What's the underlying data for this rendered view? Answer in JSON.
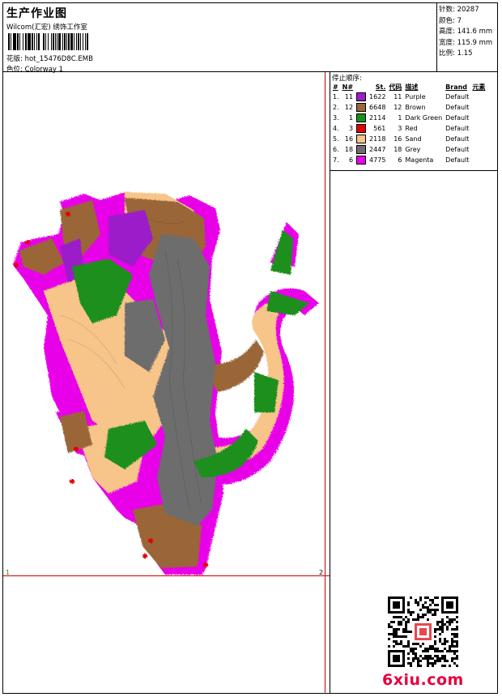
{
  "header": {
    "title": "生产作业图",
    "company": "Wilcom(汇宏) 绣饰工作室",
    "pattern_label": "花版:",
    "pattern_value": "hot_15476D8C.EMB",
    "color_label": "色位:",
    "color_value": "Colorway 1"
  },
  "stats": {
    "stitches_label": "针数:",
    "stitches": "20287",
    "colors_label": "颜色:",
    "colors": "7",
    "height_label": "高度:",
    "height": "141.6 mm",
    "width_label": "宽度:",
    "width": "115.9 mm",
    "scale_label": "比例:",
    "scale": "1.15"
  },
  "stop_sequence": {
    "title": "停止顺序:",
    "columns": [
      "#",
      "N#",
      "St.",
      "代码",
      "描述",
      "Brand",
      "元素"
    ],
    "rows": [
      {
        "idx": "1.",
        "n": "11",
        "color": "#9b1fc9",
        "st": "1622",
        "code": "11",
        "desc": "Purple",
        "brand": "Default"
      },
      {
        "idx": "2.",
        "n": "12",
        "color": "#9a6638",
        "st": "6648",
        "code": "12",
        "desc": "Brown",
        "brand": "Default"
      },
      {
        "idx": "3.",
        "n": "1",
        "color": "#1a8f1a",
        "st": "2114",
        "code": "1",
        "desc": "Dark Green",
        "brand": "Default"
      },
      {
        "idx": "4.",
        "n": "3",
        "color": "#e30000",
        "st": "561",
        "code": "3",
        "desc": "Red",
        "brand": "Default"
      },
      {
        "idx": "5.",
        "n": "16",
        "color": "#f7c489",
        "st": "2118",
        "code": "16",
        "desc": "Sand",
        "brand": "Default"
      },
      {
        "idx": "6.",
        "n": "18",
        "color": "#6d6d6d",
        "st": "2447",
        "code": "18",
        "desc": "Grey",
        "brand": "Default"
      },
      {
        "idx": "7.",
        "n": "6",
        "color": "#e800e8",
        "st": "4775",
        "code": "6",
        "desc": "Magenta",
        "brand": "Default"
      }
    ]
  },
  "canvas": {
    "start_marker": "1",
    "end_marker": "2"
  },
  "watermark": {
    "text": "6xiu.com"
  }
}
